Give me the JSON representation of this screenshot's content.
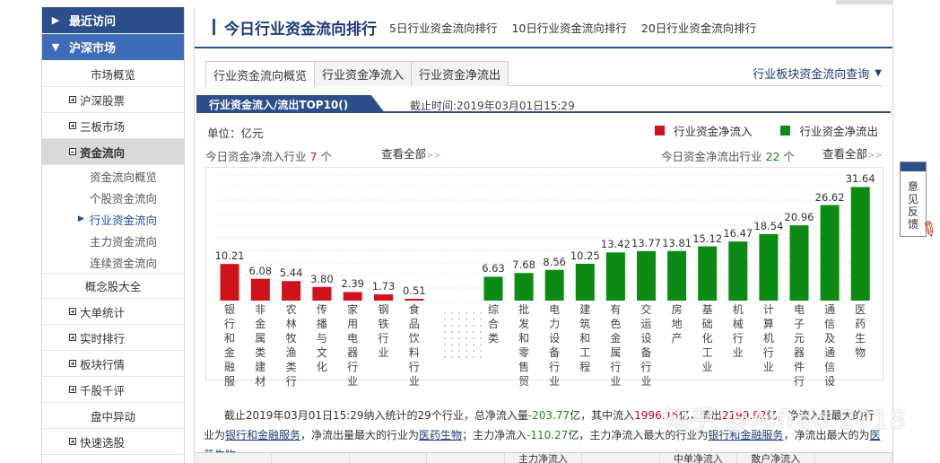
{
  "sidebar": {
    "heads": [
      {
        "label": "最近访问",
        "arrow": "▶"
      },
      {
        "label": "沪深市场",
        "arrow": "▼"
      }
    ],
    "items": {
      "market_overview": "市场概览",
      "hs_stocks": "沪深股票",
      "sanban": "三板市场",
      "fund_flow": "资金流向",
      "concept": "概念股大全",
      "big_orders": "大单统计",
      "realtime_rank": "实时排行",
      "sector_quotes": "板块行情",
      "qiangu": "千股千评",
      "pan_anomaly": "盘中异动",
      "quick_pick": "快速选股"
    },
    "subs": [
      "资金流向概览",
      "个股资金流向",
      "行业资金流向",
      "主力资金流向",
      "连续资金流向"
    ],
    "current_marker": "▶"
  },
  "header": {
    "title": "今日行业资金流向排行",
    "links": [
      "5日行业资金流向排行",
      "10日行业资金流向排行",
      "20日行业资金流向排行"
    ]
  },
  "tabs": [
    "行业资金流向概览",
    "行业资金净流入",
    "行业资金净流出"
  ],
  "sector_query": "行业板块资金流向查询",
  "section": {
    "title": "行业资金流入/流出TOP10()",
    "deadline": "截止时间:2019年03月01日15:29"
  },
  "unit": "单位：亿元",
  "legend": {
    "inflow": "行业资金净流入",
    "outflow": "行业资金净流出"
  },
  "counts": {
    "inflow_prefix": "今日资金净流入行业",
    "inflow_num": "7",
    "inflow_suffix": "个",
    "outflow_prefix": "今日资金净流出行业",
    "outflow_num": "22",
    "outflow_suffix": "个",
    "view_all": "查看全部",
    "view_all_arrow": ">>"
  },
  "colors": {
    "inflow": "#d0121b",
    "outflow": "#0b8a14",
    "brand": "#2c4f8c"
  },
  "chart_data": {
    "type": "bar",
    "series": [
      {
        "name": "行业资金净流入",
        "categories": [
          "银行和金融服",
          "非金属类建材",
          "农林牧渔类行",
          "传播与文化",
          "家用电器行业",
          "钢铁行业",
          "食品饮料行业"
        ],
        "values": [
          10.21,
          6.08,
          5.44,
          3.8,
          2.39,
          1.73,
          0.51
        ]
      },
      {
        "name": "行业资金净流出",
        "categories": [
          "综合类",
          "批发和零售贸",
          "电力设备行业",
          "建筑和工程",
          "有色金属行业",
          "交运设备行业",
          "房地产",
          "基础化工业",
          "机械行业",
          "计算机行业",
          "电子元器件行",
          "通信及通信设",
          "医药生物"
        ],
        "values": [
          6.63,
          7.68,
          8.56,
          10.25,
          13.42,
          13.77,
          13.81,
          15.12,
          16.47,
          18.54,
          20.96,
          26.62,
          31.64
        ]
      }
    ],
    "ylim": [
      0,
      32
    ]
  },
  "summary": {
    "p1": "截止2019年03月01日15:29纳入统计的29个行业，总净流入量",
    "total": "-203.77",
    "p2": "亿，其中流入",
    "inflow": "1996.15",
    "p3": "亿，流出",
    "outflow": "2199.92",
    "p4": "亿，净流入量最大的行业为",
    "link1": "银行和金融服务",
    "p5": "，净流出量最大的行业为",
    "link2": "医药生物",
    "p6": "；主力净流入",
    "main_net": "-110.27",
    "p7": "亿，主力净流入最大的行业为",
    "link3": "银行和金融服务",
    "p8": "，净流出最大的为",
    "link4": "医药生物"
  },
  "bottom_cols": [
    "",
    "",
    "",
    "",
    "主力净流入",
    "",
    "中单净流入",
    "散户净流入",
    ""
  ],
  "feedback": "意见反馈",
  "watermark": "知乎 @Alfred 2018"
}
